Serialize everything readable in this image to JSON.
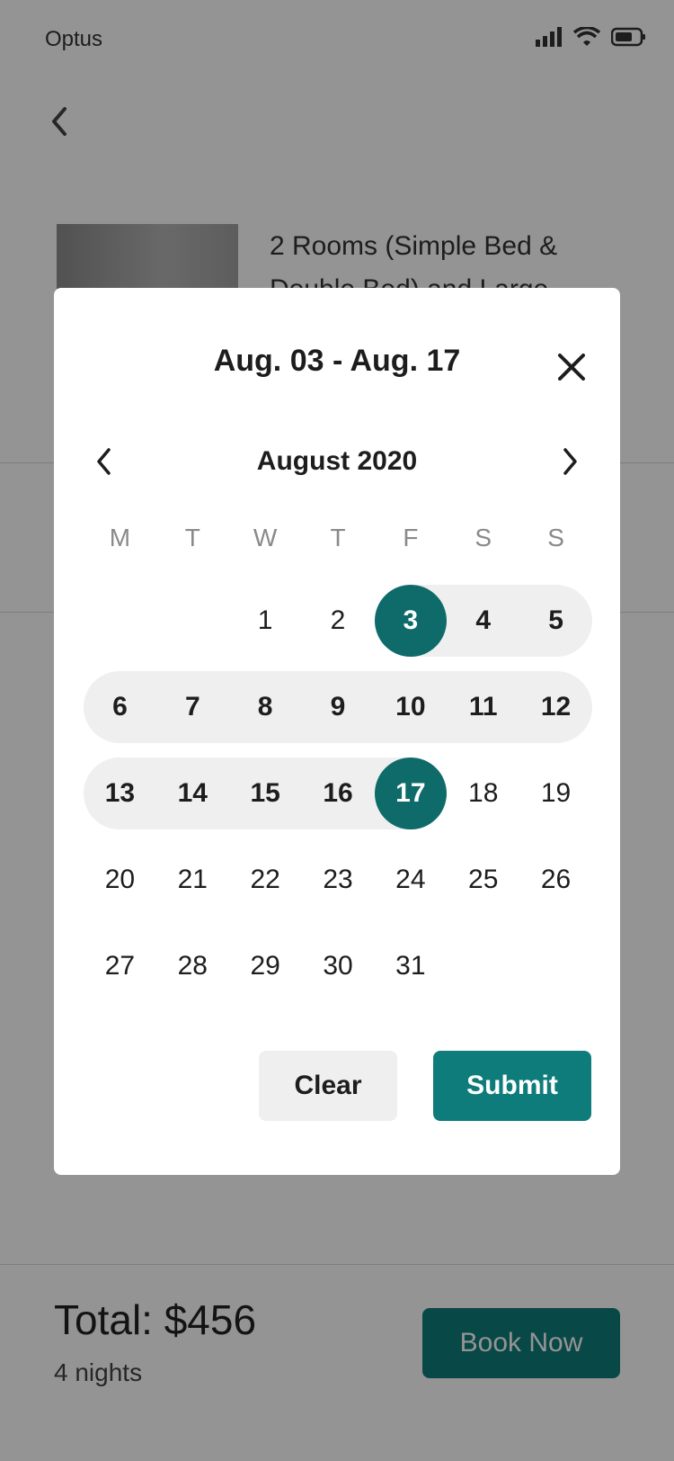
{
  "status_bar": {
    "carrier": "Optus",
    "icons": [
      "signal-icon",
      "wifi-icon",
      "battery-icon"
    ]
  },
  "listing": {
    "title": "2 Rooms (Simple Bed & Double Bed) and Large"
  },
  "footer": {
    "total": "Total: $456",
    "nights": "4 nights",
    "book_label": "Book Now"
  },
  "modal": {
    "title": "Aug. 03 - Aug. 17",
    "month_label": "August 2020",
    "weekdays": [
      "M",
      "T",
      "W",
      "T",
      "F",
      "S",
      "S"
    ],
    "weeks": [
      [
        "",
        "",
        "1",
        "2",
        "3",
        "4",
        "5"
      ],
      [
        "6",
        "7",
        "8",
        "9",
        "10",
        "11",
        "12"
      ],
      [
        "13",
        "14",
        "15",
        "16",
        "17",
        "18",
        "19"
      ],
      [
        "20",
        "21",
        "22",
        "23",
        "24",
        "25",
        "26"
      ],
      [
        "27",
        "28",
        "29",
        "30",
        "31",
        "",
        ""
      ]
    ],
    "range_start": 3,
    "range_end": 17,
    "clear_label": "Clear",
    "submit_label": "Submit"
  },
  "colors": {
    "accent": "#0e7c7b",
    "selected_day": "#0e6b6a",
    "range_fill": "#efefef",
    "scrim": "rgba(0,0,0,0.42)"
  }
}
